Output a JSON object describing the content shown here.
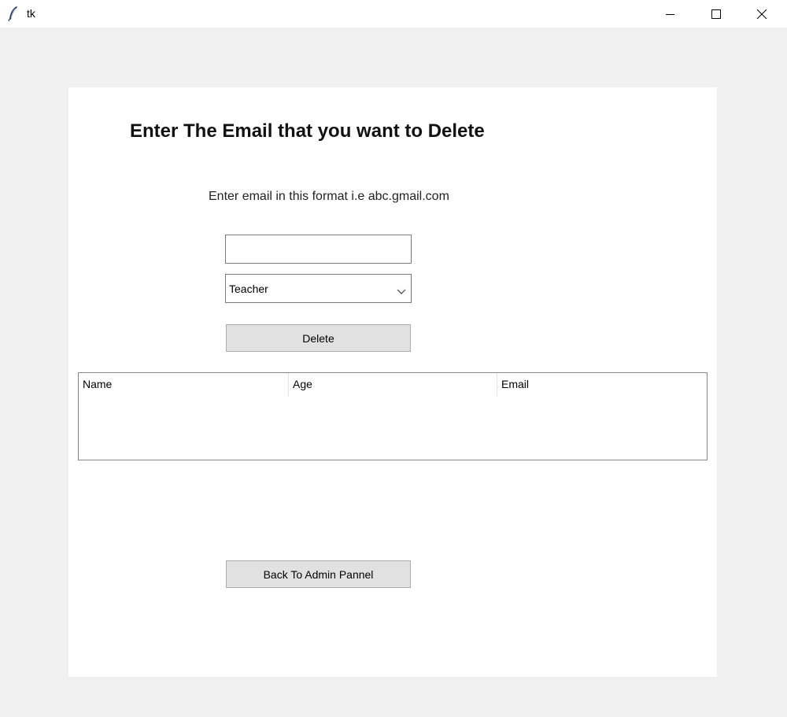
{
  "window": {
    "title": "tk",
    "icon": "tk-feather-icon"
  },
  "form": {
    "heading": "Enter The Email that you want to Delete",
    "hint": "Enter email in this format i.e abc.gmail.com",
    "email_input": {
      "value": "",
      "placeholder": ""
    },
    "role_select": {
      "selected": "Teacher"
    },
    "delete_label": "Delete",
    "back_label": "Back To Admin Pannel"
  },
  "table": {
    "columns": [
      "Name",
      "Age",
      "Email"
    ],
    "rows": []
  }
}
